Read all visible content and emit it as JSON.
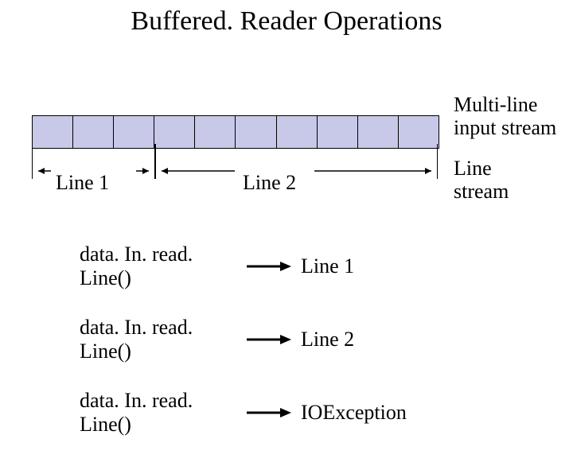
{
  "title": "Buffered. Reader Operations",
  "stream_label_line1": "Multi-line",
  "stream_label_line2": "input stream",
  "boxes": 10,
  "range1_label": "Line 1",
  "range2_label": "Line 2",
  "line_stream_label_line1": "Line",
  "line_stream_label_line2": "stream",
  "ops": [
    {
      "call": "data. In. read. Line()",
      "result": "Line 1"
    },
    {
      "call": "data. In. read. Line()",
      "result": "Line 2"
    },
    {
      "call": "data. In. read. Line()",
      "result": "IOException"
    }
  ]
}
